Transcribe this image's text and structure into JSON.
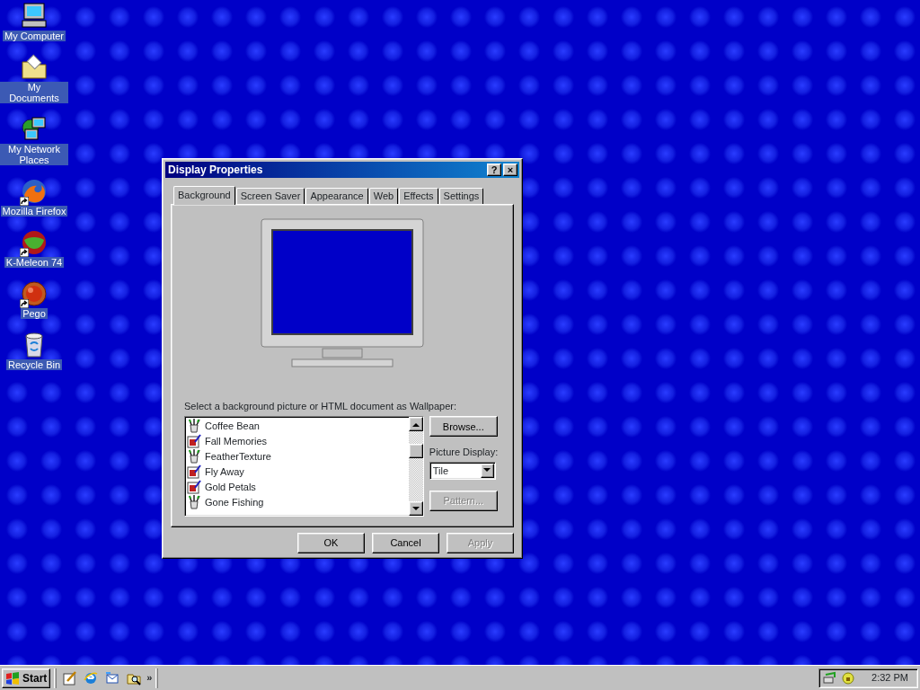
{
  "desktop_icons": [
    {
      "kind": "computer",
      "label": "My Computer",
      "shortcut": false
    },
    {
      "kind": "documents",
      "label": "My Documents",
      "shortcut": false
    },
    {
      "kind": "network",
      "label": "My Network Places",
      "shortcut": false
    },
    {
      "kind": "firefox",
      "label": "Mozilla Firefox",
      "shortcut": true
    },
    {
      "kind": "kmeleon",
      "label": "K-Meleon 74",
      "shortcut": true
    },
    {
      "kind": "pego",
      "label": "Pego",
      "shortcut": true
    },
    {
      "kind": "recycle",
      "label": "Recycle Bin",
      "shortcut": false
    }
  ],
  "window": {
    "title": "Display Properties",
    "title_buttons": [
      "?",
      "×"
    ],
    "tabs": [
      {
        "label": "Background",
        "selected": true
      },
      {
        "label": "Screen Saver",
        "selected": false
      },
      {
        "label": "Appearance",
        "selected": false
      },
      {
        "label": "Web",
        "selected": false
      },
      {
        "label": "Effects",
        "selected": false
      },
      {
        "label": "Settings",
        "selected": false
      }
    ],
    "wallpaper_label": "Select a background picture or HTML document as Wallpaper:",
    "wallpapers": [
      {
        "kind": "html",
        "label": "Coffee Bean",
        "selected": false
      },
      {
        "kind": "bitmap",
        "label": "Fall Memories",
        "selected": false
      },
      {
        "kind": "html",
        "label": "FeatherTexture",
        "selected": false
      },
      {
        "kind": "bitmap",
        "label": "Fly Away",
        "selected": false
      },
      {
        "kind": "bitmap",
        "label": "Gold Petals",
        "selected": false
      },
      {
        "kind": "html",
        "label": "Gone Fishing",
        "selected": false
      }
    ],
    "browse_button": {
      "label": "Browse...",
      "disabled": false
    },
    "picture_display": {
      "label": "Picture Display:",
      "value": "Tile"
    },
    "pattern_button": {
      "label": "Pattern...",
      "disabled": true
    },
    "buttons": [
      {
        "label": "OK",
        "disabled": false
      },
      {
        "label": "Cancel",
        "disabled": false
      },
      {
        "label": "Apply",
        "disabled": true
      }
    ]
  },
  "taskbar": {
    "start": "Start",
    "more": "»",
    "clock": "2:32 PM"
  }
}
